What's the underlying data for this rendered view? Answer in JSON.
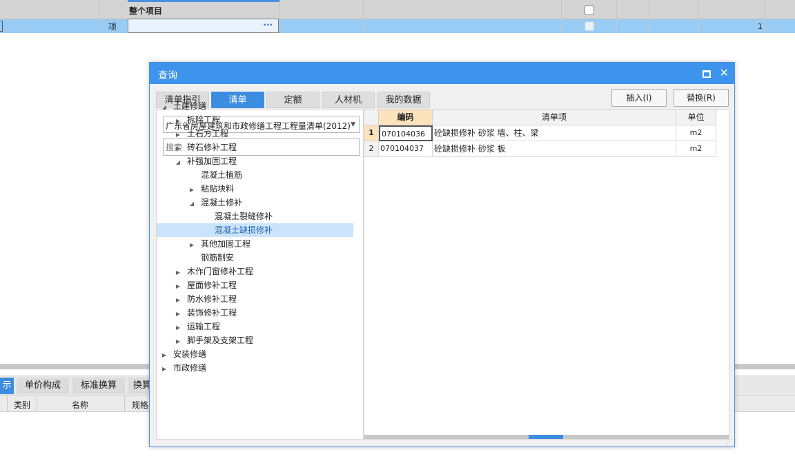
{
  "background": {
    "row1_title": "整个项目",
    "row2_type": "项",
    "row2_button": "···",
    "row2_qty": "1",
    "bottom_tabs": [
      {
        "label": "示",
        "active": true
      },
      {
        "label": "单价构成",
        "active": false
      },
      {
        "label": "标准换算",
        "active": false
      },
      {
        "label": "换算",
        "active": false
      }
    ],
    "bottom_headers": [
      "类别",
      "名称",
      "规格"
    ]
  },
  "dialog": {
    "title": "查询",
    "tabs": [
      {
        "label": "清单指引",
        "active": false
      },
      {
        "label": "清单",
        "active": true
      },
      {
        "label": "定额",
        "active": false
      },
      {
        "label": "人材机",
        "active": false
      },
      {
        "label": "我的数据",
        "active": false
      }
    ],
    "insert_button": "插入(I)",
    "replace_button": "替换(R)",
    "dropdown_value": "广东省房屋建筑和市政修缮工程工程量清单(2012)",
    "search_placeholder": "搜索",
    "tree": [
      {
        "label": "土建修缮",
        "level": 0,
        "state": "expanded",
        "selected": false
      },
      {
        "label": "拆除工程",
        "level": 1,
        "state": "collapsed",
        "selected": false
      },
      {
        "label": "土石方工程",
        "level": 1,
        "state": "collapsed",
        "selected": false
      },
      {
        "label": "砖石修补工程",
        "level": 1,
        "state": "collapsed",
        "selected": false
      },
      {
        "label": "补强加固工程",
        "level": 1,
        "state": "expanded",
        "selected": false
      },
      {
        "label": "混凝土植筋",
        "level": 2,
        "state": "leaf",
        "selected": false
      },
      {
        "label": "粘贴块料",
        "level": 2,
        "state": "collapsed",
        "selected": false
      },
      {
        "label": "混凝土修补",
        "level": 2,
        "state": "expanded",
        "selected": false
      },
      {
        "label": "混凝土裂缝修补",
        "level": 3,
        "state": "leaf",
        "selected": false
      },
      {
        "label": "混凝土缺损修补",
        "level": 3,
        "state": "leaf",
        "selected": true
      },
      {
        "label": "其他加固工程",
        "level": 2,
        "state": "collapsed",
        "selected": false
      },
      {
        "label": "钢筋制安",
        "level": 2,
        "state": "leaf",
        "selected": false
      },
      {
        "label": "木作门窗修补工程",
        "level": 1,
        "state": "collapsed",
        "selected": false
      },
      {
        "label": "屋面修补工程",
        "level": 1,
        "state": "collapsed",
        "selected": false
      },
      {
        "label": "防水修补工程",
        "level": 1,
        "state": "collapsed",
        "selected": false
      },
      {
        "label": "装饰修补工程",
        "level": 1,
        "state": "collapsed",
        "selected": false
      },
      {
        "label": "运输工程",
        "level": 1,
        "state": "collapsed",
        "selected": false
      },
      {
        "label": "脚手架及支架工程",
        "level": 1,
        "state": "collapsed",
        "selected": false
      },
      {
        "label": "安装修缮",
        "level": 0,
        "state": "collapsed",
        "selected": false
      },
      {
        "label": "市政修缮",
        "level": 0,
        "state": "collapsed",
        "selected": false
      }
    ],
    "grid_headers": {
      "code": "编码",
      "name": "清单项",
      "unit": "单位"
    },
    "grid_rows": [
      {
        "num": "1",
        "code": "070104036",
        "name": "砼缺损修补 砂浆 墙、柱、梁",
        "unit": "m2"
      },
      {
        "num": "2",
        "code": "070104037",
        "name": "砼缺损修补 砂浆 板",
        "unit": "m2"
      }
    ]
  }
}
